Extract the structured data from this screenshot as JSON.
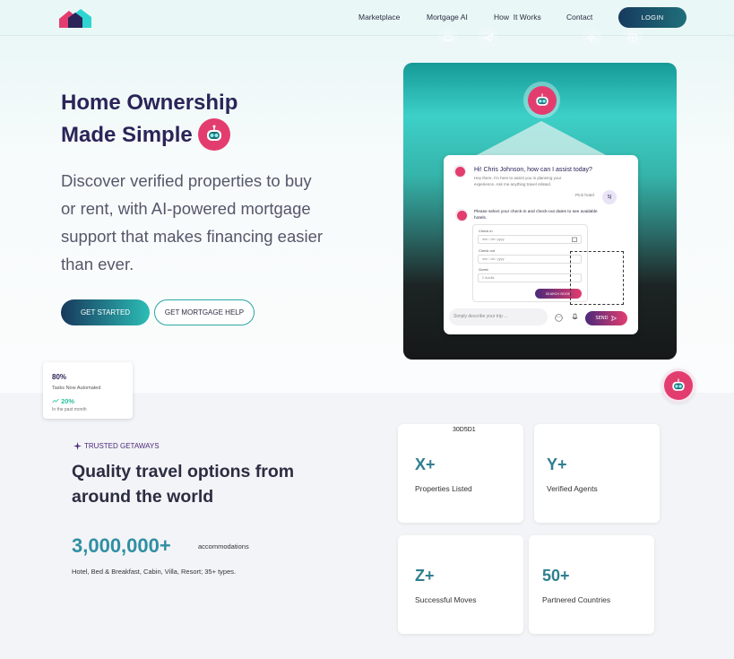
{
  "nav": {
    "links": [
      "Marketplace",
      "Mortgage AI",
      "How  It Works",
      "Contact"
    ],
    "login_label": "LOGIN"
  },
  "hero": {
    "title_line1": "Home Ownership",
    "title_line2": "Made Simple",
    "description": "Discover verified properties to buy or rent, with AI-powered mortgage support that makes financing easier than ever.",
    "primary_cta": "GET STARTED",
    "secondary_cta": "GET MORTGAGE HELP"
  },
  "chat": {
    "categories": [
      "car-icon",
      "plane-icon",
      "bot-icon",
      "cloud-umbrella-icon",
      "plus-icon"
    ],
    "greeting": "Hi! Chris Johnson, how can I assist today?",
    "sub": "Hey there, I'm here to assist you in planning your experience. Ask me anything travel related.",
    "pick_hotel": "Pick hotel",
    "user_initials": "SJ",
    "select_prompt": "Please select your check-in and check-out dates to see available hotels.",
    "check_in_label": "Check in",
    "check_in_placeholder": "mm / dd / yyyy",
    "check_out_label": "Check out",
    "check_out_placeholder": "mm / dd / yyyy",
    "guest_label": "Guest",
    "guest_value": "2 Adults",
    "search_room": "SEARCH ROOM",
    "input_placeholder": "Simply describe your trip ...",
    "send_label": "SEND"
  },
  "stat_card": {
    "percent": "80%",
    "caption": "Tasks Now Automated",
    "trend": "20%",
    "trend_caption": "In the past month"
  },
  "trusted": {
    "eyebrow": "TRUSTED GETAWAYS",
    "title": "Quality travel options from around the world",
    "big_number": "3,000,000+",
    "big_unit": "accommodations",
    "types": "Hotel, Bed & Breakfast, Cabin, Villa, Resort; 35+ types."
  },
  "color_code": "30D5D1",
  "cards": [
    {
      "value": "X+",
      "label": "Properties Listed"
    },
    {
      "value": "Y+",
      "label": "Verified Agents"
    },
    {
      "value": "Z+",
      "label": "Successful Moves"
    },
    {
      "value": "50+",
      "label": "Partnered Countries"
    }
  ],
  "colors": {
    "brand_dark": "#2a2458",
    "accent_teal": "#30D5D1",
    "accent_pink": "#e33d6f",
    "stat_blue": "#2f8fa3"
  }
}
